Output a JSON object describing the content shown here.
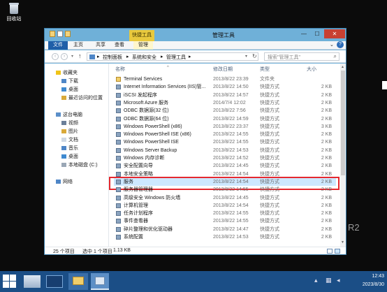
{
  "desktop": {
    "recycle_bin_label": "回收站",
    "watermark": "R2"
  },
  "window": {
    "title": "管理工具",
    "context_tab": "快捷工具",
    "ribbon_tabs": {
      "file": "文件",
      "home": "主页",
      "share": "共享",
      "view": "查看",
      "manage": "管理"
    },
    "controls": {
      "minimize": "—",
      "maximize": "☐",
      "close": "✕"
    }
  },
  "address_bar": {
    "breadcrumb": [
      "控制面板",
      "系统和安全",
      "管理工具"
    ],
    "separator": "▸",
    "search_placeholder": "搜索\"管理工具\""
  },
  "nav_pane": {
    "favorites": {
      "label": "收藏夹",
      "items": [
        "下载",
        "桌面",
        "最近访问的位置"
      ]
    },
    "this_pc": {
      "label": "这台电脑",
      "items": [
        "视频",
        "图片",
        "文档",
        "音乐",
        "桌面",
        "本地磁盘 (C:)"
      ]
    },
    "network": "网络"
  },
  "file_list": {
    "columns": {
      "name": "名称",
      "date": "修改日期",
      "type": "类型",
      "size": "大小"
    },
    "rows": [
      {
        "name": "Terminal Services",
        "date": "2013/8/22 23:39",
        "type": "文件夹",
        "size": ""
      },
      {
        "name": "Internet Information Services (IIS)管...",
        "date": "2013/8/22 14:50",
        "type": "快捷方式",
        "size": "2 KB"
      },
      {
        "name": "iSCSI 发起程序",
        "date": "2013/8/22 14:57",
        "type": "快捷方式",
        "size": "2 KB"
      },
      {
        "name": "Microsoft Azure 服务",
        "date": "2014/7/4 12:02",
        "type": "快捷方式",
        "size": "2 KB"
      },
      {
        "name": "ODBC 数据源(32 位)",
        "date": "2013/8/22 7:56",
        "type": "快捷方式",
        "size": "2 KB"
      },
      {
        "name": "ODBC 数据源(64 位)",
        "date": "2013/8/22 14:59",
        "type": "快捷方式",
        "size": "2 KB"
      },
      {
        "name": "Windows PowerShell (x86)",
        "date": "2013/8/22 23:37",
        "type": "快捷方式",
        "size": "3 KB"
      },
      {
        "name": "Windows PowerShell ISE (x86)",
        "date": "2013/8/22 14:55",
        "type": "快捷方式",
        "size": "2 KB"
      },
      {
        "name": "Windows PowerShell ISE",
        "date": "2013/8/22 14:55",
        "type": "快捷方式",
        "size": "2 KB"
      },
      {
        "name": "Windows Server Backup",
        "date": "2013/8/22 14:53",
        "type": "快捷方式",
        "size": "2 KB"
      },
      {
        "name": "Windows 内存诊断",
        "date": "2013/8/22 14:52",
        "type": "快捷方式",
        "size": "2 KB"
      },
      {
        "name": "安全配置向导",
        "date": "2013/8/22 14:45",
        "type": "快捷方式",
        "size": "2 KB"
      },
      {
        "name": "本地安全策略",
        "date": "2013/8/22 14:54",
        "type": "快捷方式",
        "size": "2 KB"
      },
      {
        "name": "服务",
        "date": "2013/8/22 14:54",
        "type": "快捷方式",
        "size": "2 KB",
        "selected": true
      },
      {
        "name": "服务器管理器",
        "date": "2013/8/22 14:55",
        "type": "快捷方式",
        "size": "2 KB"
      },
      {
        "name": "高级安全 Windows 防火墙",
        "date": "2013/8/22 14:45",
        "type": "快捷方式",
        "size": "2 KB"
      },
      {
        "name": "计算机管理",
        "date": "2013/8/22 14:54",
        "type": "快捷方式",
        "size": "2 KB"
      },
      {
        "name": "任务计划程序",
        "date": "2013/8/22 14:55",
        "type": "快捷方式",
        "size": "2 KB"
      },
      {
        "name": "事件查看器",
        "date": "2013/8/22 14:55",
        "type": "快捷方式",
        "size": "2 KB"
      },
      {
        "name": "碎片整理和优化驱动器",
        "date": "2013/8/22 14:47",
        "type": "快捷方式",
        "size": "2 KB"
      },
      {
        "name": "系统配置",
        "date": "2013/8/22 14:53",
        "type": "快捷方式",
        "size": "2 KB"
      }
    ]
  },
  "status_bar": {
    "count": "25 个项目",
    "selection": "选中 1 个项目",
    "size": "1.13 KB"
  },
  "taskbar": {
    "time": "12:43",
    "date": "2023/8/30"
  },
  "colors": {
    "window_frame": "#6fb0d8",
    "accent": "#1f5fa8",
    "context_tab": "#e9c93d",
    "selection": "#cde8ff",
    "highlight_box": "#e5282f",
    "taskbar": "#1b4e86"
  }
}
